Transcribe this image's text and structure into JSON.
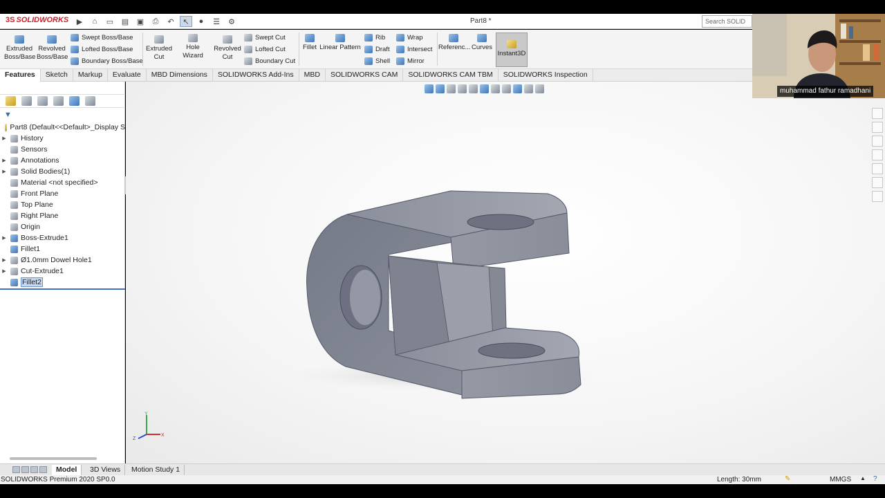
{
  "app": {
    "logo": "SOLIDWORKS",
    "logo_mark": "3S",
    "doc_title": "Part8 *",
    "search_placeholder": "Search SOLID"
  },
  "ribbon": {
    "extruded_boss": "Extruded Boss/Base",
    "revolved_boss": "Revolved Boss/Base",
    "swept_boss": "Swept Boss/Base",
    "lofted_boss": "Lofted Boss/Base",
    "boundary_boss": "Boundary Boss/Base",
    "extruded_cut": "Extruded Cut",
    "hole_wizard": "Hole Wizard",
    "revolved_cut": "Revolved Cut",
    "swept_cut": "Swept Cut",
    "lofted_cut": "Lofted Cut",
    "boundary_cut": "Boundary Cut",
    "fillet": "Fillet",
    "linear_pattern": "Linear Pattern",
    "rib": "Rib",
    "draft": "Draft",
    "shell": "Shell",
    "wrap": "Wrap",
    "intersect": "Intersect",
    "mirror": "Mirror",
    "reference": "Referenc...",
    "curves": "Curves",
    "instant3d": "Instant3D"
  },
  "tabs": [
    "Features",
    "Sketch",
    "Markup",
    "Evaluate",
    "MBD Dimensions",
    "SOLIDWORKS Add-Ins",
    "MBD",
    "SOLIDWORKS CAM",
    "SOLIDWORKS CAM TBM",
    "SOLIDWORKS Inspection"
  ],
  "tree": {
    "root": "Part8  (Default<<Default>_Display S",
    "items": [
      {
        "label": "History",
        "expandable": true
      },
      {
        "label": "Sensors",
        "expandable": false
      },
      {
        "label": "Annotations",
        "expandable": true
      },
      {
        "label": "Solid Bodies(1)",
        "expandable": true
      },
      {
        "label": "Material <not specified>",
        "expandable": false
      },
      {
        "label": "Front Plane",
        "expandable": false
      },
      {
        "label": "Top Plane",
        "expandable": false
      },
      {
        "label": "Right Plane",
        "expandable": false
      },
      {
        "label": "Origin",
        "expandable": false
      },
      {
        "label": "Boss-Extrude1",
        "expandable": true
      },
      {
        "label": "Fillet1",
        "expandable": false
      },
      {
        "label": "Ø1.0mm Dowel Hole1",
        "expandable": true
      },
      {
        "label": "Cut-Extrude1",
        "expandable": true
      },
      {
        "label": "Fillet2",
        "expandable": false,
        "selected": true
      }
    ]
  },
  "webcam": {
    "participant": "muhammad fathur ramadhani"
  },
  "bottom_tabs": [
    "Model",
    "3D Views",
    "Motion Study 1"
  ],
  "status": {
    "product": "SOLIDWORKS Premium 2020 SP0.0",
    "length": "Length: 30mm",
    "units": "MMGS"
  },
  "triad": {
    "x": "X",
    "y": "Y",
    "z": "Z"
  },
  "colors": {
    "accent": "#3e73b9",
    "part_face": "#8e929d",
    "brand": "#d0202b"
  }
}
